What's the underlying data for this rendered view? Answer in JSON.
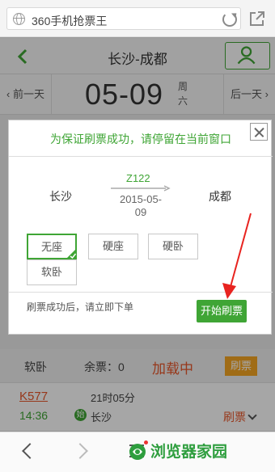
{
  "browser": {
    "address": "360手机抢票王"
  },
  "header": {
    "route": "长沙-成都"
  },
  "date_row": {
    "prev": "前一天",
    "date": "05-09",
    "weekday": "周六",
    "next": "后一天"
  },
  "modal": {
    "warning": "为保证刷票成功，请停留在当前窗口",
    "from": "长沙",
    "to": "成都",
    "train": "Z122",
    "date_line1": "2015-05-",
    "date_line2": "09",
    "seats": [
      {
        "label": "无座",
        "selected": true
      },
      {
        "label": "硬座",
        "selected": false
      },
      {
        "label": "硬卧",
        "selected": false
      },
      {
        "label": "软卧",
        "selected": false
      }
    ],
    "hint": "刷票成功后，请立即下单",
    "start_label": "开始刷票"
  },
  "list": {
    "soft_sleeper": {
      "seat": "软卧",
      "remain": "余票：0",
      "status": "加载中",
      "action": "刷票"
    },
    "train": {
      "number": "K577",
      "duration": "21时05分",
      "time": "14:36",
      "start_badge": "始",
      "from": "长沙",
      "action": "刷票"
    }
  },
  "watermark": "浏览器家园",
  "colors": {
    "accent": "#3fa535",
    "warn": "#e8572a",
    "button_orange": "#f6a623",
    "arrow": "#e8231f"
  }
}
